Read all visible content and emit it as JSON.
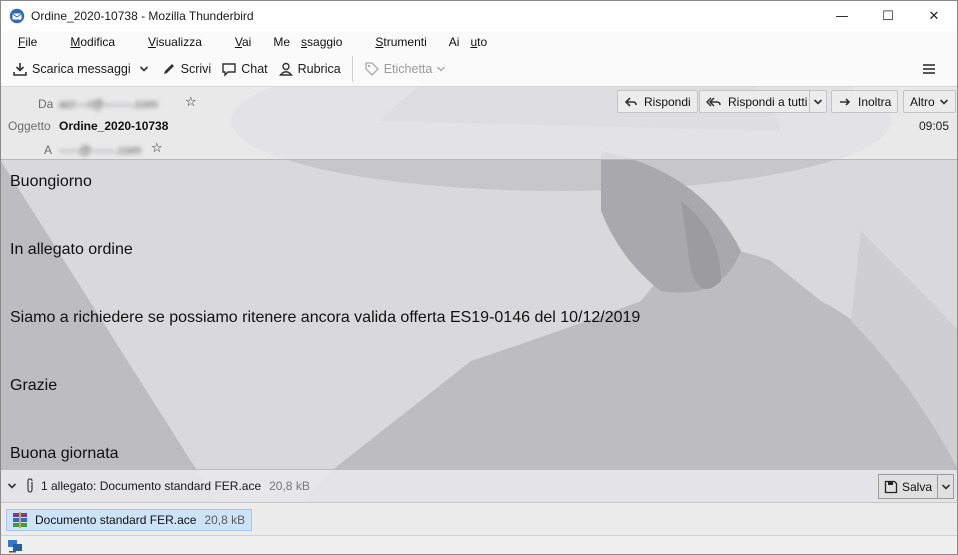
{
  "window": {
    "title": "Ordine_2020-10738 - Mozilla Thunderbird",
    "controls": {
      "minimize": "—",
      "maximize": "☐",
      "close": "✕"
    }
  },
  "menubar": {
    "items": [
      {
        "pre": "",
        "key": "F",
        "post": "ile"
      },
      {
        "pre": "",
        "key": "M",
        "post": "odifica"
      },
      {
        "pre": "",
        "key": "V",
        "post": "isualizza"
      },
      {
        "pre": "",
        "key": "V",
        "post": "ai"
      },
      {
        "pre": "Me",
        "key": "s",
        "post": "saggio"
      },
      {
        "pre": "",
        "key": "S",
        "post": "trumenti"
      },
      {
        "pre": "Ai",
        "key": "u",
        "post": "to"
      }
    ]
  },
  "toolbar": {
    "get_messages": "Scarica messaggi",
    "write": "Scrivi",
    "chat": "Chat",
    "address_book": "Rubrica",
    "tag": "Etichetta"
  },
  "header": {
    "from_label": "Da",
    "from_value": "acr---r@-------.com",
    "subject_label": "Oggetto",
    "subject_value": "Ordine_2020-10738",
    "to_label": "A",
    "to_value": "-----@------.com",
    "time": "09:05",
    "buttons": {
      "reply": "Rispondi",
      "reply_all": "Rispondi a tutti",
      "forward": "Inoltra",
      "more": "Altro"
    }
  },
  "body": {
    "lines": [
      "Buongiorno",
      "In allegato ordine",
      "Siamo a richiedere se possiamo ritenere ancora valida offerta ES19-0146 del 10/12/2019",
      "Grazie",
      "Buona giornata"
    ]
  },
  "attachments": {
    "summary": "1 allegato: Documento standard FER.ace",
    "summary_size": "20,8 kB",
    "save_label": "Salva",
    "items": [
      {
        "name": "Documento standard FER.ace",
        "size": "20,8 kB"
      }
    ]
  },
  "colors": {
    "selection": "#cde3f7",
    "header_bg": "#eeeef0"
  }
}
